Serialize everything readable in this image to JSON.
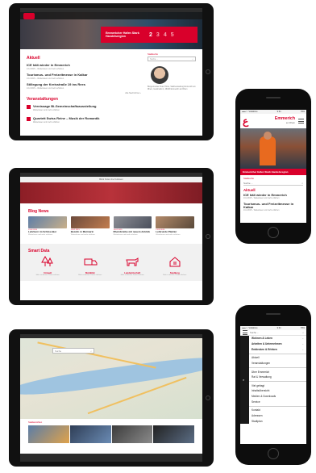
{
  "tablet_home": {
    "hero": {
      "logo_label": "Emmerich",
      "box_text": "Emmericher Hafen Stark Handelsregion",
      "nums": [
        "2",
        "3",
        "4",
        "5"
      ]
    },
    "sections": {
      "news_title": "Aktuell",
      "events_title": "Veranstaltungen"
    },
    "news": [
      {
        "h": "ICE hält wieder in Emmerich",
        "p": "13.2.2015 – Weiterlesen und mehr erfahren"
      },
      {
        "h": "Tourismus- und Freizeitmesse in Kalkar",
        "p": "13.2.2015 – Weiterlesen und mehr erfahren"
      },
      {
        "h": "Stillegung der Kreisstraße 19 ins Rees",
        "p": "13.2.2015 – Weiterlesen und mehr erfahren"
      }
    ],
    "news_more": "Alle Nachrichten ›",
    "events": [
      {
        "h": "Vernissage Bi-Gemeinschaftsausstellung",
        "p": "Weiterlesen und mehr erfahren"
      },
      {
        "h": "Quartett Swiss Reine – Musik der Romantik",
        "p": "Weiterlesen und mehr erfahren"
      }
    ],
    "side": {
      "search_label": "Stadtsuche",
      "search_placeholder": "Suche ...",
      "search_icon": "magnifier",
      "contact_text": "Bürgermeister Peter Hinze, Stadtverwaltung Emmerich am Rhein, Geistmarkt 1, 46446 Emmerich am Rhein"
    }
  },
  "tablet_blog": {
    "topbar": "Blick hinter die Kulissen",
    "blog_title": "Blog News",
    "cards": [
      {
        "date": "13.02.2015",
        "h": "Lehrburn im Schlossiker",
        "p": "Weiterlesen und mehr erfahren"
      },
      {
        "date": "13.02.2015",
        "h": "Bezahl- in Marinarin",
        "p": "Weiterlesen und mehr erfahren"
      },
      {
        "date": "13.02.2015",
        "h": "Rheinbrücke mit neuem Anblick",
        "p": "Weiterlesen und mehr erfahren"
      },
      {
        "date": "13.02.2015",
        "h": "Leihrunde Platzler",
        "p": "Weiterlesen und mehr erfahren"
      }
    ],
    "smart_title": "Smart Data",
    "smart": [
      {
        "label": "Umwelt",
        "p": "Mehr zu diesem Thema erfahren"
      },
      {
        "label": "Mobilität",
        "p": "Mehr zu diesem Thema erfahren"
      },
      {
        "label": "Landwirtschaft",
        "p": "Mehr zu diesem Thema erfahren"
      },
      {
        "label": "Siedlung",
        "p": "Mehr zu diesem Thema erfahren"
      }
    ]
  },
  "tablet_map": {
    "search_placeholder": "Suche",
    "gallery_label": "Stadtansichten"
  },
  "phone_home": {
    "status": {
      "carrier": "●●●○○ Vodafone",
      "time": "9:31",
      "battery": "79%"
    },
    "brand": "Emmerich",
    "brand_sub": "am Rhein",
    "hero_caption": "Emmericher Hafen Stark Handelsregion",
    "search_label": "Stadtsuche",
    "search_placeholder": "Suche ...",
    "section_title": "Aktuell",
    "news": [
      {
        "h": "ICE hält wieder in Emmerich",
        "p": "13.2.2015 – Weiterlesen und mehr erfahren"
      },
      {
        "h": "Tourismus- und Freizeitmesse in Kalkar",
        "p": "13.2.2015 – Weiterlesen und mehr erfahren"
      }
    ]
  },
  "phone_menu": {
    "status": {
      "carrier": "●●●○○ Vodafone",
      "time": "9:31",
      "battery": "79%"
    },
    "search_placeholder": "Suche ...",
    "groups": [
      [
        "Wohnen & Leben",
        "Arbeiten & Unternehmen",
        "Entdecken & Erleben"
      ],
      [
        "Aktuell",
        "Veranstaltungen"
      ],
      [
        "Über Emmerich",
        "Rat & Verwaltung"
      ],
      [
        "Viel gefragt",
        "Inhaltsübersicht",
        "Medien & Downloads",
        "Service"
      ],
      [
        "Kontakt",
        "Adressen",
        "Stadtplan"
      ]
    ]
  }
}
